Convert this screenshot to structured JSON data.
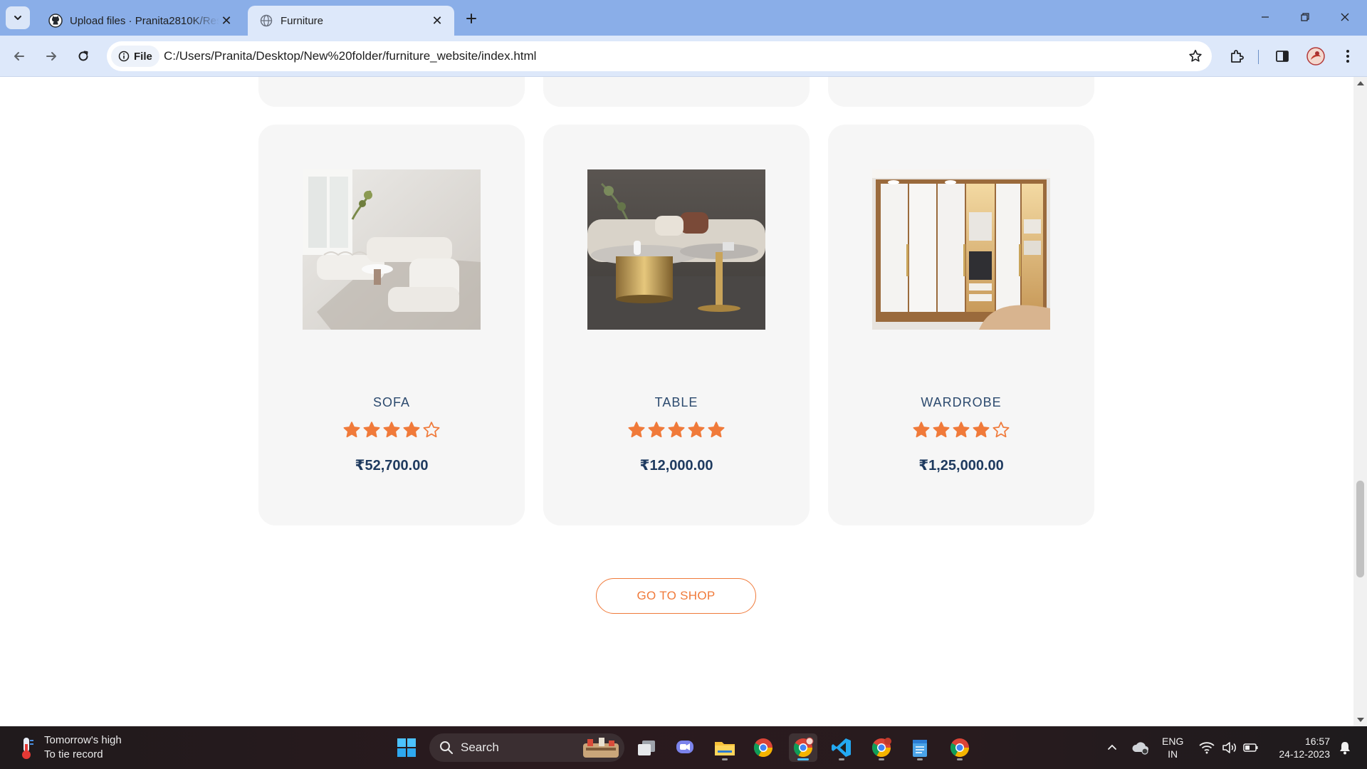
{
  "browser": {
    "tabs": [
      {
        "title": "Upload files · Pranita2810K/Res",
        "favicon": "github-icon",
        "active": false
      },
      {
        "title": "Furniture",
        "favicon": "globe-icon",
        "active": true
      }
    ],
    "address": {
      "chip_label": "File",
      "url": "C:/Users/Pranita/Desktop/New%20folder/furniture_website/index.html"
    }
  },
  "products": [
    {
      "name": "SOFA",
      "rating": 4,
      "max_rating": 5,
      "price": "₹52,700.00",
      "image": "sofa-photo"
    },
    {
      "name": "TABLE",
      "rating": 5,
      "max_rating": 5,
      "price": "₹12,000.00",
      "image": "table-photo"
    },
    {
      "name": "WARDROBE",
      "rating": 4,
      "max_rating": 5,
      "price": "₹1,25,000.00",
      "image": "wardrobe-photo"
    }
  ],
  "cta": {
    "label": "GO TO SHOP"
  },
  "colors": {
    "accent": "#f07a3a",
    "title_text": "#2c4a6e",
    "price_text": "#1e3a5f",
    "card_bg": "#f6f6f6"
  },
  "taskbar": {
    "weather": {
      "line1": "Tomorrow's high",
      "line2": "To tie record"
    },
    "search_label": "Search",
    "language": {
      "line1": "ENG",
      "line2": "IN"
    },
    "clock": {
      "time": "16:57",
      "date": "24-12-2023"
    }
  }
}
